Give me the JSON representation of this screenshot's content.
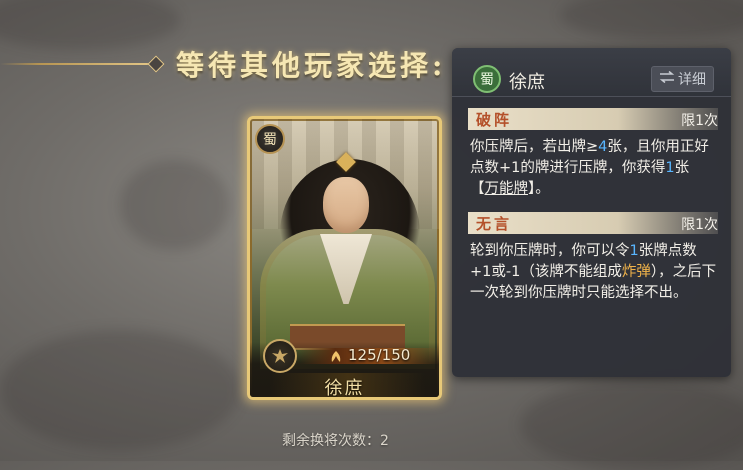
{
  "title": "等待其他玩家选择:",
  "remaining_label": "剩余换将次数：2",
  "card": {
    "faction": "蜀",
    "hp": "125/150",
    "name": "徐庶"
  },
  "panel": {
    "faction": "蜀",
    "name": "徐庶",
    "detail_label": "详细",
    "skills": [
      {
        "name": "破阵",
        "limit": "限1次",
        "desc_parts": {
          "p1": "你压牌后，若出牌≥",
          "p2": "4",
          "p3": "张，且你用正好点数+1的牌进行压牌，你获得",
          "p4": "1",
          "p5": "张【",
          "p6": "万能牌",
          "p7": "】。"
        }
      },
      {
        "name": "无言",
        "limit": "限1次",
        "desc_parts": {
          "p1": "轮到你压牌时，你可以令",
          "p2": "1",
          "p3": "张牌点数+1或-1（该牌不能组成",
          "p4": "炸弹",
          "p5": "），之后下一次轮到你压牌时只能选择不出。"
        }
      }
    ]
  },
  "colors": {
    "card_border": "#e8c978",
    "panel_bg": "#2e3037",
    "highlight_blue": "#59b6ff",
    "highlight_gold": "#f0b34a",
    "skill_name": "#b4502a",
    "shu_green": "#3b6e3a"
  },
  "icons": [
    "shu-faction-icon",
    "swap-arrows-icon",
    "leaf-hp-icon",
    "eagle-emblem-icon"
  ]
}
